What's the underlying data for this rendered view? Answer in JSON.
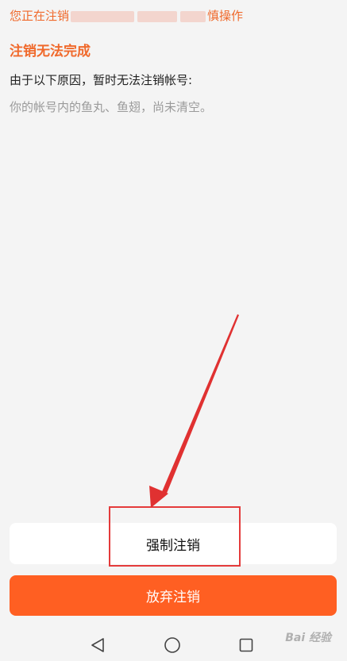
{
  "notice": {
    "prefix": "您正在注销",
    "suffix": "慎操作"
  },
  "status": {
    "title": "注销无法完成",
    "reason_label": "由于以下原因，暂时无法注销帐号:",
    "reason_text": "你的帐号内的鱼丸、鱼翅，尚未清空。"
  },
  "buttons": {
    "force_logout": "强制注销",
    "cancel_logout": "放弃注销"
  },
  "navbar": {
    "back_icon": "back-triangle-icon",
    "home_icon": "home-circle-icon",
    "recent_icon": "recent-square-icon"
  },
  "watermark": {
    "text": "Bai 经验"
  },
  "colors": {
    "accent": "#f0692b",
    "cancel_button": "#ff5f22",
    "highlight": "#e43b3b",
    "background": "#f4f4f4"
  }
}
